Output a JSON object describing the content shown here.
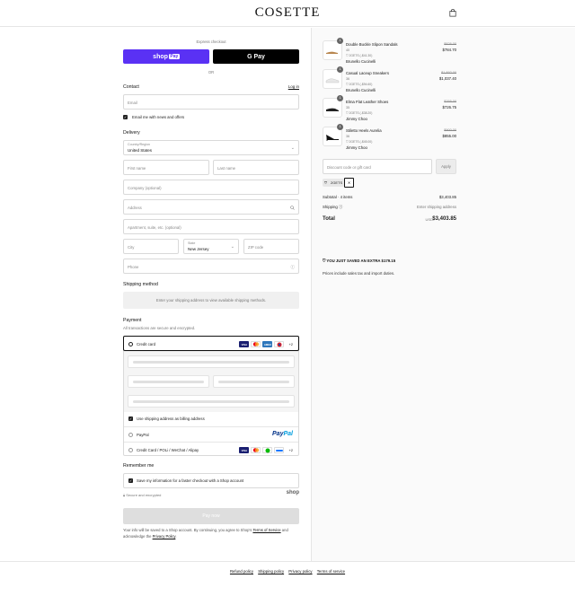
{
  "brand": {
    "logo": "COSETTE",
    "tagline": "—"
  },
  "express": {
    "label": "Express checkout",
    "shop_pay": "shop",
    "shop_pay_badge": "Pay",
    "gpay": "G Pay",
    "or": "OR"
  },
  "contact": {
    "title": "Contact",
    "login": "Log in",
    "email_placeholder": "Email",
    "news_label": "Email me with news and offers"
  },
  "delivery": {
    "title": "Delivery",
    "country_label": "Country/Region",
    "country_value": "United States",
    "first_name": "First name",
    "last_name": "Last name",
    "company": "Company (optional)",
    "address": "Address",
    "apartment": "Apartment, suite, etc. (optional)",
    "city": "City",
    "state_label": "State",
    "state_value": "New Jersey",
    "zip": "ZIP code",
    "phone": "Phone"
  },
  "shipping_method": {
    "title": "Shipping method",
    "message": "Enter your shipping address to view available shipping methods."
  },
  "payment": {
    "title": "Payment",
    "subtitle": "All transactions are secure and encrypted.",
    "credit_card": "Credit card",
    "more_cards": "+2",
    "use_shipping": "Use shipping address as billing address",
    "paypal": "PayPal",
    "paypal_logo_a": "Pay",
    "paypal_logo_b": "Pal",
    "alt_methods": "Credit Card / POLi / WeChat / Alipay",
    "alt_more": "+2"
  },
  "remember": {
    "title": "Remember me",
    "save_info": "Save my information for a faster checkout with a Shop account",
    "secure": "Secure and encrypted",
    "shop_logo": "shop"
  },
  "pay_now": "Pay now",
  "legal": {
    "prefix": "Your info will be saved to a Shop account. By continuing, you agree to Shop's ",
    "terms": "Terms of Service",
    "middle": " and acknowledge the ",
    "privacy": "Privacy Policy",
    "suffix": "."
  },
  "footer": [
    "Refund policy",
    "Shipping policy",
    "Privacy policy",
    "Terms of service"
  ],
  "summary": {
    "items": [
      {
        "qty": "1",
        "name": "Double Buckle Slipon Sandals",
        "size": "40",
        "discount": "2GETS (-$41.30)",
        "brand": "Brunello Cucinelli",
        "old": "$826.00",
        "new": "$784.70"
      },
      {
        "qty": "1",
        "name": "Casual Laceup Sneakers",
        "size": "36",
        "discount": "2GETS (-$94.60)",
        "brand": "Brunello Cucinelli",
        "old": "$1,892.00",
        "new": "$1,037.40"
      },
      {
        "qty": "1",
        "name": "Elma Flat Leather Shoes",
        "size": "35",
        "discount": "2GETS (-$38.20)",
        "brand": "Jimmy Choo",
        "old": "$765.00",
        "new": "$726.75"
      },
      {
        "qty": "1",
        "name": "Stiletto Heels Aurelia",
        "size": "36",
        "discount": "2GETS (-$45.00)",
        "brand": "Jimmy Choo",
        "old": "$900.00",
        "new": "$855.00"
      }
    ],
    "discount_placeholder": "Discount code or gift card",
    "apply": "Apply",
    "code_tag": "2GETS",
    "subtotal_label": "Subtotal · 4 items",
    "subtotal_value": "$3,403.85",
    "shipping_label": "Shipping",
    "shipping_value": "Enter shipping address",
    "total_label": "Total",
    "currency": "USD",
    "total_value": "$3,403.85",
    "saved": "YOU JUST SAVED AN EXTRA  $179.15",
    "tax_note": "Prices include sales tax and import duties."
  },
  "colors": {
    "shop_purple": "#5a31f4",
    "gpay_black": "#000000",
    "visa": "#1a1f71",
    "mastercard": "#eb001b",
    "amex": "#2e77bc"
  }
}
